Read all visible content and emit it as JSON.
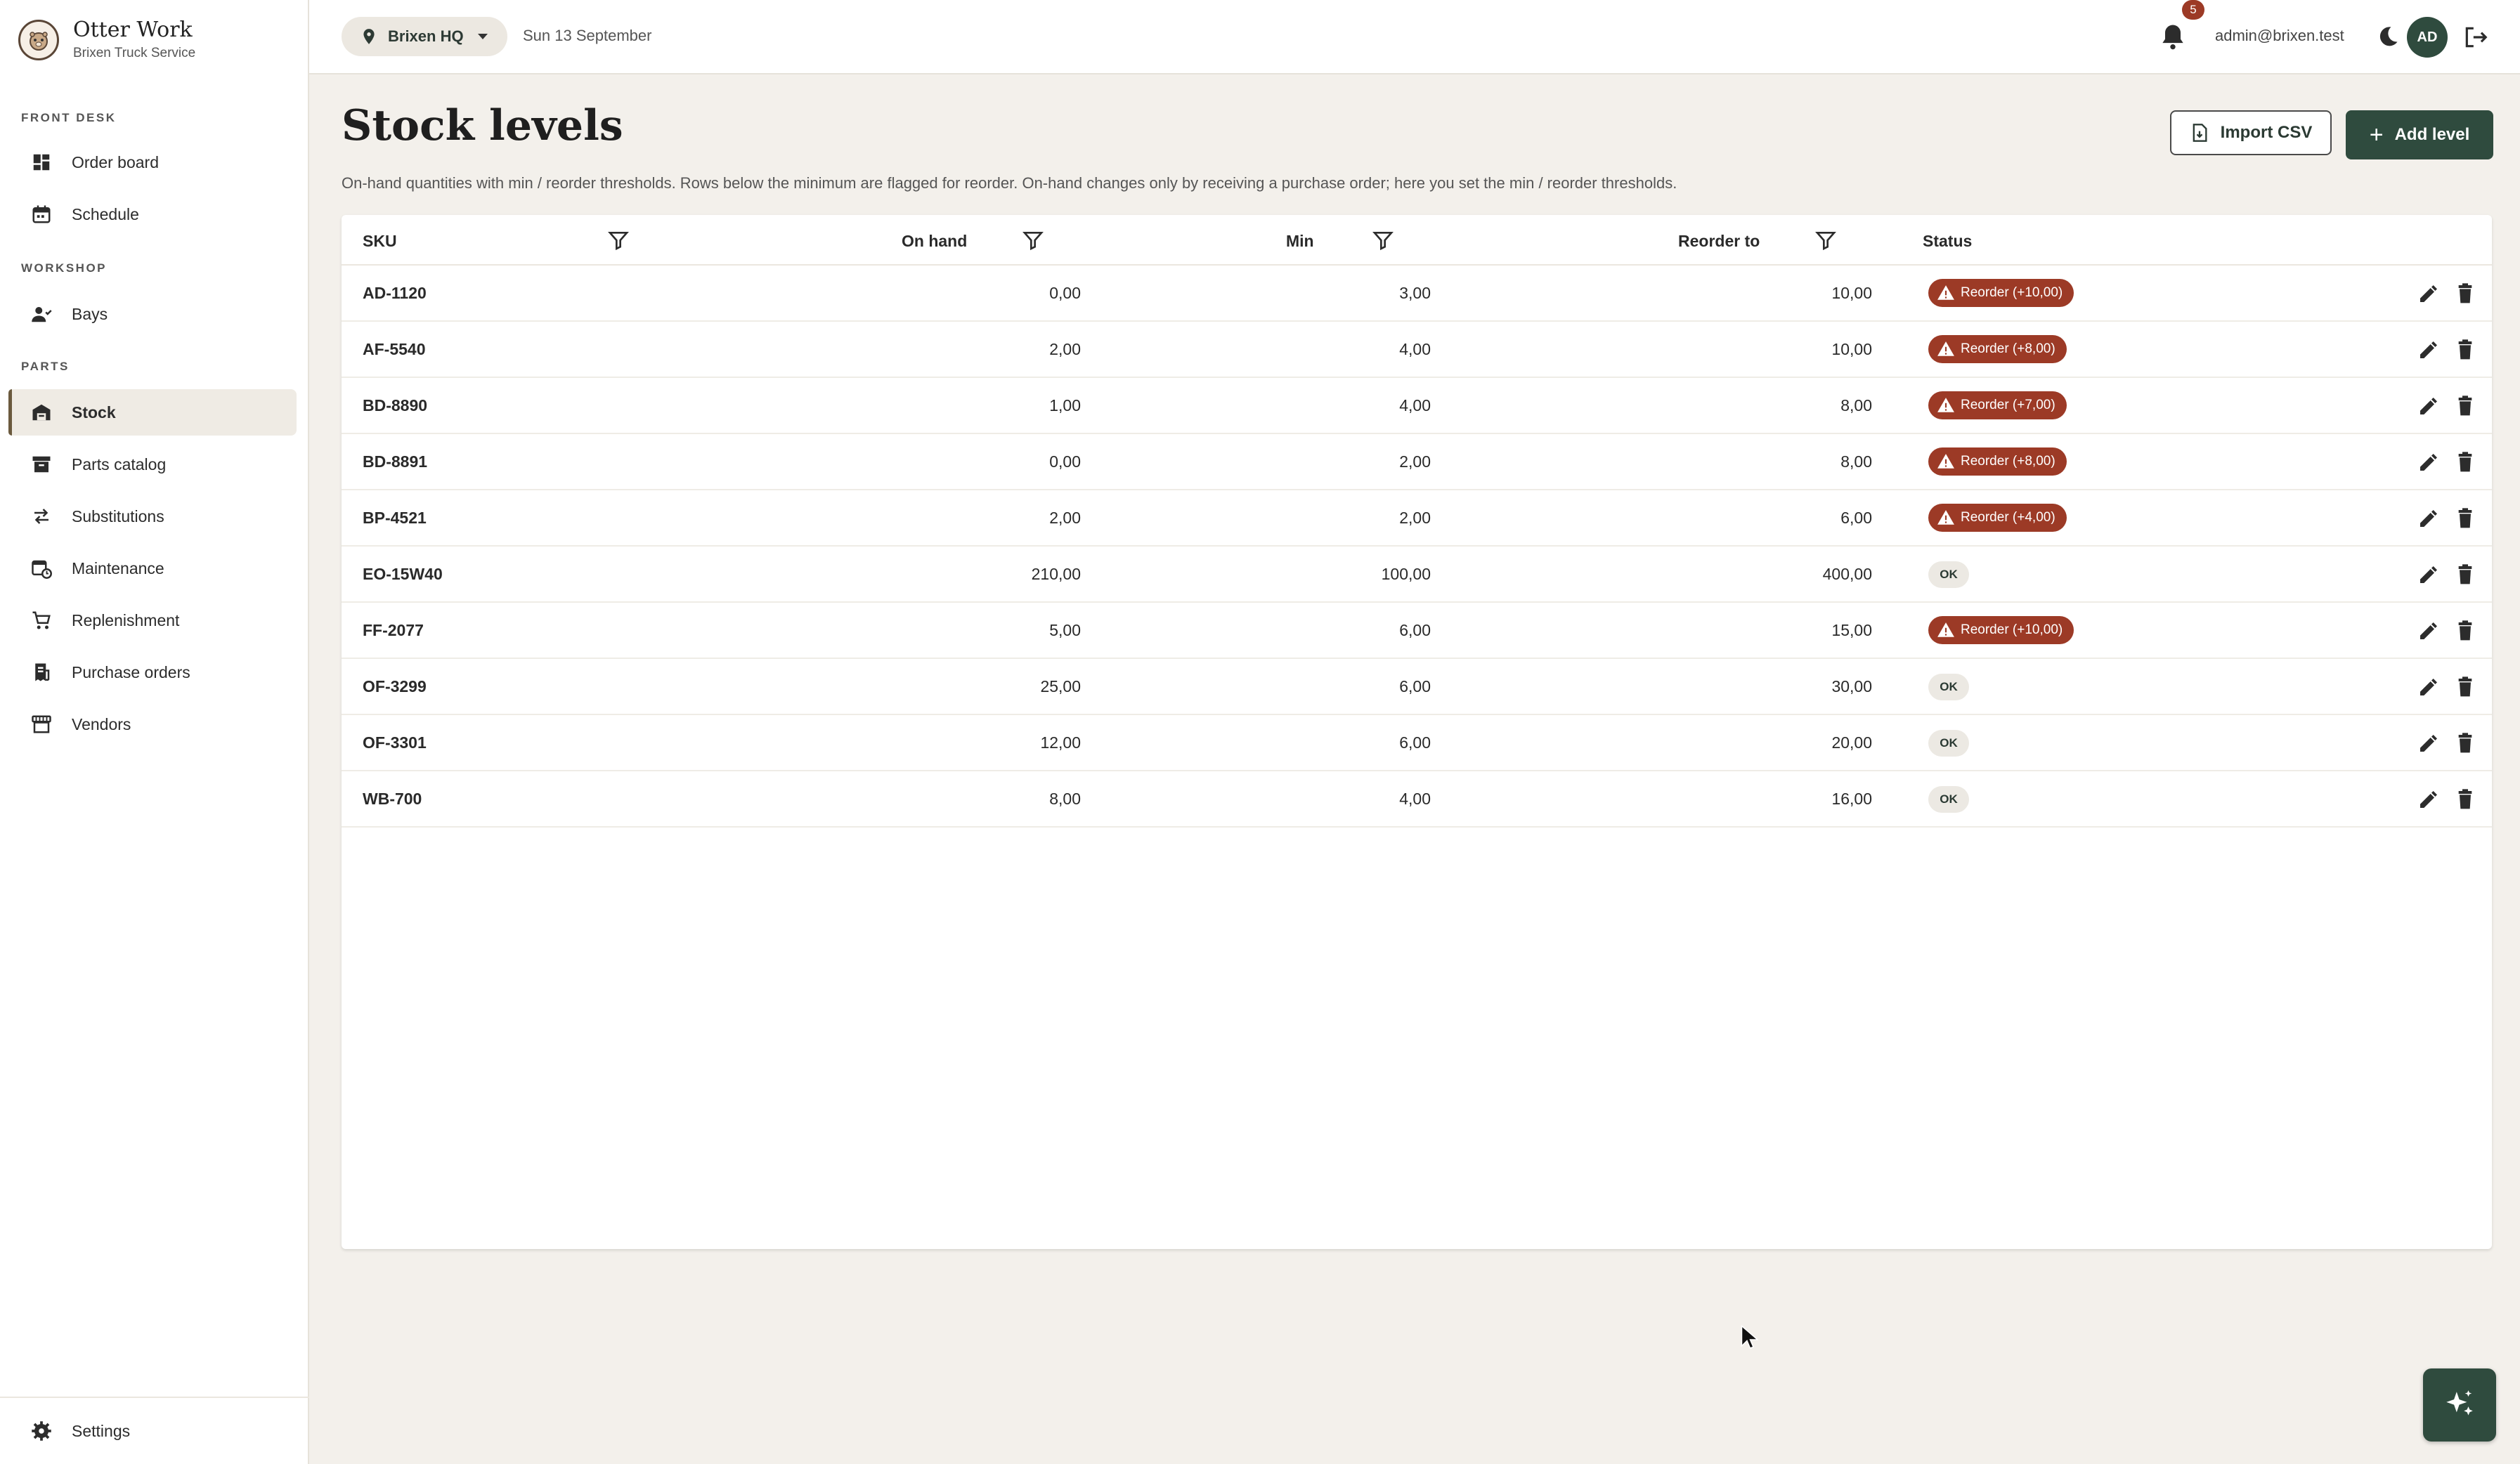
{
  "brand": {
    "title": "Otter Work",
    "subtitle": "Brixen Truck Service"
  },
  "sidebar": {
    "sections": [
      {
        "label": "FRONT DESK"
      },
      {
        "label": "WORKSHOP"
      },
      {
        "label": "PARTS"
      }
    ],
    "items": [
      {
        "label": "Order board",
        "icon": "dashboard-icon"
      },
      {
        "label": "Schedule",
        "icon": "calendar-icon"
      },
      {
        "label": "Bays",
        "icon": "people-icon"
      },
      {
        "label": "Stock",
        "icon": "warehouse-icon",
        "active": true
      },
      {
        "label": "Parts catalog",
        "icon": "archive-icon"
      },
      {
        "label": "Substitutions",
        "icon": "swap-icon"
      },
      {
        "label": "Maintenance",
        "icon": "calendar-clock-icon"
      },
      {
        "label": "Replenishment",
        "icon": "cart-icon"
      },
      {
        "label": "Purchase orders",
        "icon": "receipt-icon"
      },
      {
        "label": "Vendors",
        "icon": "store-icon"
      }
    ],
    "footer": {
      "label": "Settings",
      "icon": "gear-icon"
    }
  },
  "topbar": {
    "location": "Brixen HQ",
    "date": "Sun 13 September",
    "notifications": "5",
    "user_email": "admin@brixen.test",
    "avatar_initials": "AD"
  },
  "main": {
    "title": "Stock levels",
    "description": "On-hand quantities with min / reorder thresholds. Rows below the minimum are flagged for reorder. On-hand changes only by receiving a purchase order; here you set the min / reorder thresholds.",
    "import_label": "Import CSV",
    "add_label": "Add level"
  },
  "table": {
    "columns": {
      "sku": "SKU",
      "on_hand": "On hand",
      "min": "Min",
      "reorder_to": "Reorder to",
      "status": "Status"
    },
    "rows": [
      {
        "sku": "AD-1120",
        "on_hand": "0,00",
        "min": "3,00",
        "reorder_to": "10,00",
        "status": "Reorder (+10,00)",
        "reorder": true
      },
      {
        "sku": "AF-5540",
        "on_hand": "2,00",
        "min": "4,00",
        "reorder_to": "10,00",
        "status": "Reorder (+8,00)",
        "reorder": true
      },
      {
        "sku": "BD-8890",
        "on_hand": "1,00",
        "min": "4,00",
        "reorder_to": "8,00",
        "status": "Reorder (+7,00)",
        "reorder": true
      },
      {
        "sku": "BD-8891",
        "on_hand": "0,00",
        "min": "2,00",
        "reorder_to": "8,00",
        "status": "Reorder (+8,00)",
        "reorder": true
      },
      {
        "sku": "BP-4521",
        "on_hand": "2,00",
        "min": "2,00",
        "reorder_to": "6,00",
        "status": "Reorder (+4,00)",
        "reorder": true
      },
      {
        "sku": "EO-15W40",
        "on_hand": "210,00",
        "min": "100,00",
        "reorder_to": "400,00",
        "status": "OK",
        "reorder": false
      },
      {
        "sku": "FF-2077",
        "on_hand": "5,00",
        "min": "6,00",
        "reorder_to": "15,00",
        "status": "Reorder (+10,00)",
        "reorder": true
      },
      {
        "sku": "OF-3299",
        "on_hand": "25,00",
        "min": "6,00",
        "reorder_to": "30,00",
        "status": "OK",
        "reorder": false
      },
      {
        "sku": "OF-3301",
        "on_hand": "12,00",
        "min": "6,00",
        "reorder_to": "20,00",
        "status": "OK",
        "reorder": false
      },
      {
        "sku": "WB-700",
        "on_hand": "8,00",
        "min": "4,00",
        "reorder_to": "16,00",
        "status": "OK",
        "reorder": false
      }
    ]
  },
  "colors": {
    "accent": "#2f4b3e",
    "danger": "#9c3a26",
    "background": "#f3f0eb"
  }
}
